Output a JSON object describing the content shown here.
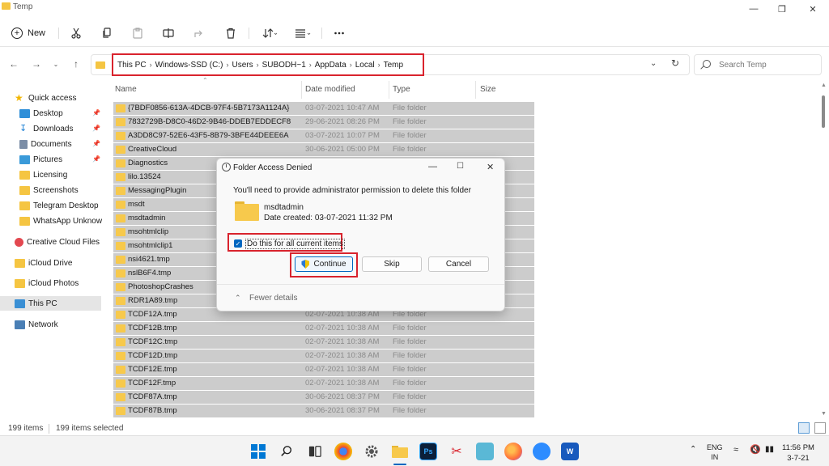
{
  "window": {
    "title": "Temp"
  },
  "toolbar": {
    "new_label": "New"
  },
  "address": {
    "crumbs": [
      "This PC",
      "Windows-SSD (C:)",
      "Users",
      "SUBODH~1",
      "AppData",
      "Local",
      "Temp"
    ],
    "search_placeholder": "Search Temp"
  },
  "sidebar": {
    "items": [
      {
        "label": "Quick access"
      },
      {
        "label": "Desktop"
      },
      {
        "label": "Downloads"
      },
      {
        "label": "Documents"
      },
      {
        "label": "Pictures"
      },
      {
        "label": "Licensing"
      },
      {
        "label": "Screenshots"
      },
      {
        "label": "Telegram Desktop"
      },
      {
        "label": "WhatsApp Unknown"
      },
      {
        "label": "Creative Cloud Files"
      },
      {
        "label": "iCloud Drive"
      },
      {
        "label": "iCloud Photos"
      },
      {
        "label": "This PC"
      },
      {
        "label": "Network"
      }
    ]
  },
  "columns": {
    "name": "Name",
    "date": "Date modified",
    "type": "Type",
    "size": "Size"
  },
  "files": [
    {
      "name": "{7BDF0856-613A-4DCB-97F4-5B7173A1124A}",
      "date": "03-07-2021 10:47 AM",
      "type": "File folder"
    },
    {
      "name": "7832729B-D8C0-46D2-9B46-DDEB7EDDECF8",
      "date": "29-06-2021 08:26 PM",
      "type": "File folder"
    },
    {
      "name": "A3DD8C97-52E6-43F5-8B79-3BFE44DEEE6A",
      "date": "03-07-2021 10:07 PM",
      "type": "File folder"
    },
    {
      "name": "CreativeCloud",
      "date": "30-06-2021 05:00 PM",
      "type": "File folder"
    },
    {
      "name": "Diagnostics",
      "date": "",
      "type": ""
    },
    {
      "name": "lilo.13524",
      "date": "",
      "type": ""
    },
    {
      "name": "MessagingPlugin",
      "date": "",
      "type": ""
    },
    {
      "name": "msdt",
      "date": "",
      "type": ""
    },
    {
      "name": "msdtadmin",
      "date": "",
      "type": ""
    },
    {
      "name": "msohtmlclip",
      "date": "",
      "type": ""
    },
    {
      "name": "msohtmlclip1",
      "date": "",
      "type": ""
    },
    {
      "name": "nsi4621.tmp",
      "date": "",
      "type": ""
    },
    {
      "name": "nslB6F4.tmp",
      "date": "",
      "type": ""
    },
    {
      "name": "PhotoshopCrashes",
      "date": "",
      "type": ""
    },
    {
      "name": "RDR1A89.tmp",
      "date": "",
      "type": ""
    },
    {
      "name": "TCDF12A.tmp",
      "date": "02-07-2021 10:38 AM",
      "type": "File folder"
    },
    {
      "name": "TCDF12B.tmp",
      "date": "02-07-2021 10:38 AM",
      "type": "File folder"
    },
    {
      "name": "TCDF12C.tmp",
      "date": "02-07-2021 10:38 AM",
      "type": "File folder"
    },
    {
      "name": "TCDF12D.tmp",
      "date": "02-07-2021 10:38 AM",
      "type": "File folder"
    },
    {
      "name": "TCDF12E.tmp",
      "date": "02-07-2021 10:38 AM",
      "type": "File folder"
    },
    {
      "name": "TCDF12F.tmp",
      "date": "02-07-2021 10:38 AM",
      "type": "File folder"
    },
    {
      "name": "TCDF87A.tmp",
      "date": "30-06-2021 08:37 PM",
      "type": "File folder"
    },
    {
      "name": "TCDF87B.tmp",
      "date": "30-06-2021 08:37 PM",
      "type": "File folder"
    }
  ],
  "status": {
    "count": "199 items",
    "selected": "199 items selected"
  },
  "dialog": {
    "title": "Folder Access Denied",
    "message": "You'll need to provide administrator permission to delete this folder",
    "folder_name": "msdtadmin",
    "folder_date": "Date created: 03-07-2021 11:32 PM",
    "checkbox_label": "Do this for all current items",
    "continue_label": "Continue",
    "skip_label": "Skip",
    "cancel_label": "Cancel",
    "details_label": "Fewer details"
  },
  "taskbar": {
    "language": "ENG",
    "region": "IN",
    "time": "11:56 PM",
    "date": "3-7-21",
    "ps_label": "Ps",
    "word_label": "W"
  }
}
